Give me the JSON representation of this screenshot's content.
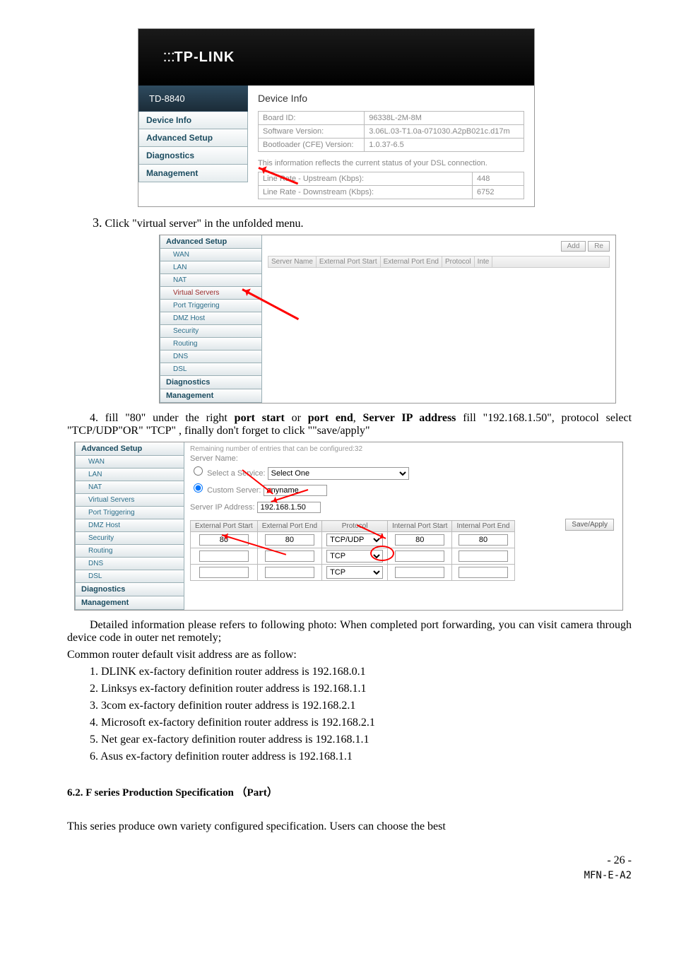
{
  "ss1": {
    "logo": "TP-LINK",
    "model": "TD-8840",
    "nav": [
      "Device Info",
      "Advanced Setup",
      "Diagnostics",
      "Management"
    ],
    "title": "Device Info",
    "rows": [
      [
        "Board ID:",
        "96338L-2M-8M"
      ],
      [
        "Software Version:",
        "3.06L.03-T1.0a-071030.A2pB021c.d17m"
      ],
      [
        "Bootloader (CFE) Version:",
        "1.0.37-6.5"
      ]
    ],
    "note": "This information reflects the current status of your DSL connection.",
    "rows2": [
      [
        "Line Rate - Upstream (Kbps):",
        "448"
      ],
      [
        "Line Rate - Downstream (Kbps):",
        "6752"
      ]
    ]
  },
  "step3": "Click \"virtual server\" in the unfolded menu.",
  "step3_num": "3.",
  "ss2": {
    "nav": [
      "Advanced Setup",
      "WAN",
      "LAN",
      "NAT",
      "Virtual Servers",
      "Port Triggering",
      "DMZ Host",
      "Security",
      "Routing",
      "DNS",
      "DSL",
      "Diagnostics",
      "Management"
    ],
    "btn_add": "Add",
    "btn_rem": "Re",
    "headers": [
      "Server Name",
      "External Port Start",
      "External Port End",
      "Protocol",
      "Inte"
    ]
  },
  "para4_a": "4. fill \"80\" under the right ",
  "para4_b": "port start",
  "para4_c": " or ",
  "para4_d": "port end",
  "para4_e": ", ",
  "para4_f": "Server IP address",
  "para4_g": " fill \"192.168.1.50\", protocol select \"TCP/UDP\"OR\" \"TCP\" , finally don't forget to click \"\"save/apply\"",
  "ss3": {
    "toptext": "Remaining number of entries that can be configured:32",
    "nav": [
      "Advanced Setup",
      "WAN",
      "LAN",
      "NAT",
      "Virtual Servers",
      "Port Triggering",
      "DMZ Host",
      "Security",
      "Routing",
      "DNS",
      "DSL",
      "Diagnostics",
      "Management"
    ],
    "lbl_servername": "Server Name:",
    "lbl_selectservice": "Select a Service:",
    "sel_selectone": "Select One",
    "lbl_custom": "Custom Server:",
    "val_custom": "anyname",
    "lbl_ip": "Server IP Address:",
    "val_ip": "192.168.1.50",
    "btn_save": "Save/Apply",
    "th": [
      "External Port Start",
      "External Port End",
      "Protocol",
      "Internal Port Start",
      "Internal Port End"
    ],
    "row_vals": [
      "80",
      "80",
      "TCP/UDP",
      "80",
      "80"
    ],
    "row2_proto": "TCP",
    "row3_proto": "TCP"
  },
  "para5": "Detailed information please refers to following photo:   When completed port forwarding, you can visit camera through device code in outer net remotely;",
  "para6": "Common router default visit address are as follow:",
  "routers": [
    "1. DLINK ex-factory definition router address is 192.168.0.1",
    "2. Linksys ex-factory definition router address is 192.168.1.1",
    "3. 3com ex-factory definition router address is 192.168.2.1",
    "4. Microsoft ex-factory definition router address is 192.168.2.1",
    "5. Net gear ex-factory definition router address is 192.168.1.1",
    "6. Asus ex-factory definition router address is 192.168.1.1"
  ],
  "section62": "6.2. F series Production Specification  （Part）",
  "closing": "This series produce own variety configured specification. Users can choose the best",
  "pagenum": "- 26 -",
  "doccode": "MFN-E-A2"
}
